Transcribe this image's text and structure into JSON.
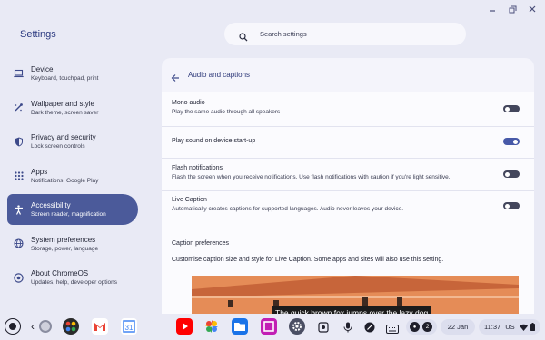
{
  "window": {
    "controls": [
      "minimize-icon",
      "restore-icon",
      "close-icon"
    ]
  },
  "app_title": "Settings",
  "search": {
    "placeholder": "Search settings",
    "icon": "search-icon"
  },
  "sidebar": {
    "items": [
      {
        "id": "device",
        "label": "Device",
        "sub": "Keyboard, touchpad, print",
        "icon": "laptop-icon",
        "active": false
      },
      {
        "id": "wallpaper",
        "label": "Wallpaper and style",
        "sub": "Dark theme, screen saver",
        "icon": "paintbrush-icon",
        "active": false
      },
      {
        "id": "privacy",
        "label": "Privacy and security",
        "sub": "Lock screen controls",
        "icon": "shield-icon",
        "active": false
      },
      {
        "id": "apps",
        "label": "Apps",
        "sub": "Notifications, Google Play",
        "icon": "apps-grid-icon",
        "active": false
      },
      {
        "id": "accessibility",
        "label": "Accessibility",
        "sub": "Screen reader, magnification",
        "icon": "accessibility-icon",
        "active": true
      },
      {
        "id": "system",
        "label": "System preferences",
        "sub": "Storage, power, language",
        "icon": "globe-icon",
        "active": false
      },
      {
        "id": "about",
        "label": "About ChromeOS",
        "sub": "Updates, help, developer options",
        "icon": "chromeos-icon",
        "active": false
      }
    ]
  },
  "page": {
    "title": "Audio and captions",
    "back_icon": "back-arrow-icon",
    "settings": [
      {
        "id": "mono-audio",
        "title": "Mono audio",
        "sub": "Play the same audio through all speakers",
        "on": false
      },
      {
        "id": "startup-sound",
        "title": "Play sound on device start-up",
        "sub": "",
        "on": true
      },
      {
        "id": "flash-notifications",
        "title": "Flash notifications",
        "sub": "Flash the screen when you receive notifications. Use flash notifications with caution if you're light sensitive.",
        "on": false
      },
      {
        "id": "live-caption",
        "title": "Live Caption",
        "sub": "Automatically creates captions for supported languages. Audio never leaves your device.",
        "on": false
      }
    ],
    "caption_prefs": {
      "title": "Caption preferences",
      "desc": "Customise caption size and style for Live Caption. Some apps and sites will also use this setting.",
      "sample_caption": "The quick brown fox jumps over the lazy dog"
    }
  },
  "shelf": {
    "apps": [
      "launcher-icon",
      "back-icon",
      "assistant-icon",
      "google-photos-icon",
      "gmail-icon",
      "calendar-icon",
      "youtube-icon",
      "photos-icon",
      "files-icon",
      "screenshot-app-icon",
      "settings-icon"
    ],
    "tray": {
      "date": "22 Jan",
      "time": "11:37",
      "locale": "US",
      "notification_count": "2"
    }
  },
  "colors": {
    "background": "#e9eaf5",
    "accent": "#4b5a9a",
    "toggle_on": "#4759a8",
    "toggle_off": "#43465c"
  }
}
